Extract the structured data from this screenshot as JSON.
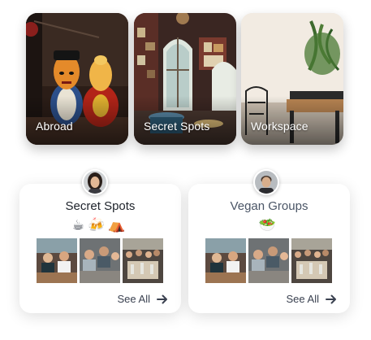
{
  "categories": [
    {
      "label": "Abroad",
      "image": "dolls-photo"
    },
    {
      "label": "Secret Spots",
      "image": "restaurant-interior-photo"
    },
    {
      "label": "Workspace",
      "image": "cafe-workspace-photo"
    }
  ],
  "groups": [
    {
      "title": "Secret Spots",
      "emojis": "☕🍻⛺",
      "avatar": "woman-avatar",
      "see_all_label": "See All"
    },
    {
      "title": "Vegan Groups",
      "emojis": "🥗",
      "avatar": "man-avatar",
      "see_all_label": "See All"
    }
  ],
  "icons": {
    "see_all": "arrow-right-icon"
  }
}
